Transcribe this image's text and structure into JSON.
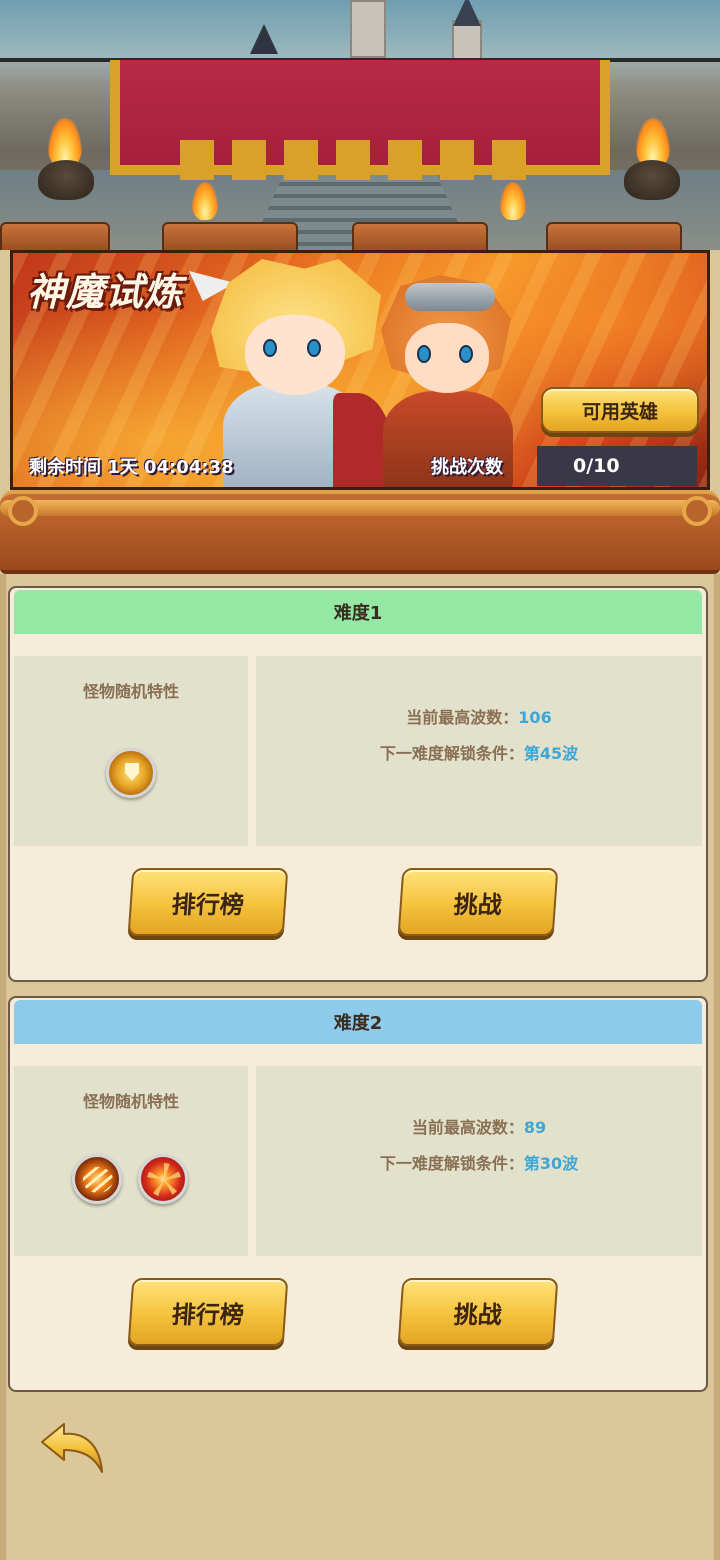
{
  "event": {
    "title": "神魔试炼",
    "remaining_time": "剩余时间 1天 04:04:38",
    "attempts_label": "挑战次数",
    "attempts_value": "0/10",
    "heroes_button": "可用英雄"
  },
  "difficulties": [
    {
      "title": "难度1",
      "header_color": "#94e8a4",
      "traits_label": "怪物随机特性",
      "trait_icons": [
        "shield-trait-icon"
      ],
      "max_wave_label": "当前最高波数：",
      "max_wave_value": "106",
      "unlock_label": "下一难度解锁条件：",
      "unlock_value": "第45波",
      "ranking_button": "排行榜",
      "challenge_button": "挑战"
    },
    {
      "title": "难度2",
      "header_color": "#8ecbea",
      "traits_label": "怪物随机特性",
      "trait_icons": [
        "slash-trait-icon",
        "burst-trait-icon"
      ],
      "max_wave_label": "当前最高波数：",
      "max_wave_value": "89",
      "unlock_label": "下一难度解锁条件：",
      "unlock_value": "第30波",
      "ranking_button": "排行榜",
      "challenge_button": "挑战"
    }
  ],
  "navigation": {
    "back_icon": "back-arrow-icon"
  },
  "colors": {
    "gold_button": "#f4c23c",
    "value_text": "#3fa6d6",
    "label_text": "#8a6f54",
    "card_bg": "#f5ecd9"
  }
}
